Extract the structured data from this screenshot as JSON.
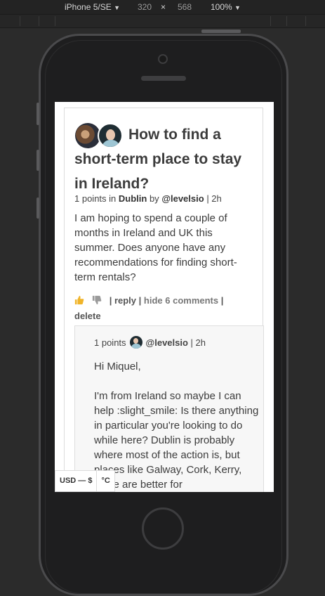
{
  "devtools": {
    "device": "iPhone 5/SE",
    "width": "320",
    "times": "×",
    "height": "568",
    "zoom": "100%",
    "caret": "▼"
  },
  "post": {
    "title": "How to find a short-term place to stay in Ireland?",
    "points": "1 points in",
    "city": "Dublin",
    "by": "by",
    "author": "@levelsio",
    "age": "| 2h",
    "body": "I am hoping to spend a couple of months in Ireland and UK this summer. Does anyone have any recommendations for finding short-term rentals?",
    "sep1": "|",
    "reply": "reply",
    "sep2": "|",
    "hide_comments": "hide 6 comments",
    "sep3": "|",
    "delete": "delete"
  },
  "comment": {
    "points": "1 points",
    "author": "@levelsio",
    "age": "| 2h",
    "greeting": "Hi Miquel,",
    "text": "I'm from Ireland so maybe I can help :slight_smile: Is there anything in particular you're looking to do while here? Dublin is probably where most of the action is, but places like Galway, Cork, Kerry, Clare are better for"
  },
  "widget": {
    "currency": "USD — $",
    "temperature": "°C"
  },
  "colors": {
    "thumb_up": "#f0b429",
    "thumb_down": "#9a9a9a"
  }
}
